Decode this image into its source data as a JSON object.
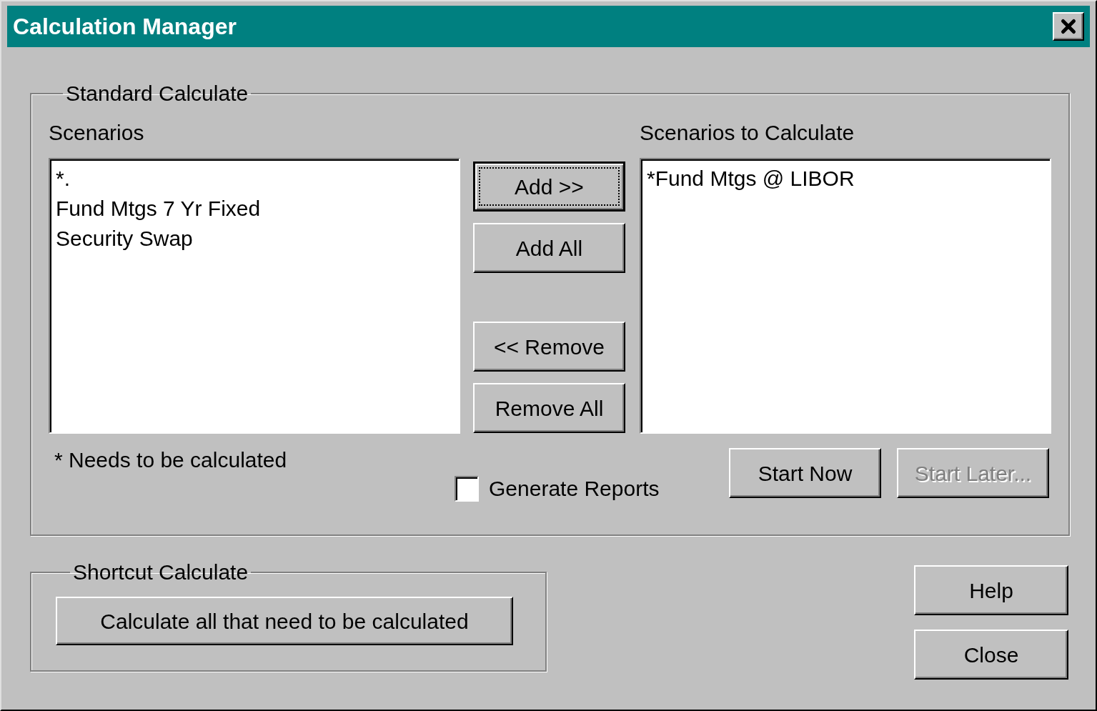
{
  "window": {
    "title": "Calculation Manager"
  },
  "standard_calculate": {
    "title": "Standard Calculate",
    "scenarios": {
      "label": "Scenarios",
      "items": [
        {
          "text": "*.",
          "selected": false
        },
        {
          "text": "Fund Mtgs 7 Yr Fixed",
          "selected": false
        },
        {
          "text": "Security Swap",
          "selected": false
        }
      ]
    },
    "move_buttons": [
      {
        "label": "Add >>",
        "focused": true,
        "disabled": false
      },
      {
        "label": "Add All",
        "focused": false,
        "disabled": false
      },
      {
        "label": "<< Remove",
        "focused": false,
        "disabled": false
      },
      {
        "label": "Remove All",
        "focused": false,
        "disabled": false
      }
    ],
    "scenarios_to_calculate": {
      "label": "Scenarios to Calculate",
      "items": [
        {
          "text": "*Fund Mtgs @ LIBOR",
          "selected": false
        }
      ]
    },
    "note": "* Needs to be calculated",
    "generate_reports": {
      "label": "Generate Reports",
      "checked": false
    },
    "start_buttons": [
      {
        "label": "Start Now",
        "focused": false,
        "disabled": false
      },
      {
        "label": "Start Later...",
        "focused": false,
        "disabled": true
      }
    ]
  },
  "shortcut_calculate": {
    "title": "Shortcut Calculate",
    "button": {
      "label": "Calculate all that need to be calculated",
      "focused": false,
      "disabled": false
    }
  },
  "side_buttons": [
    {
      "label": "Help",
      "focused": false,
      "disabled": false
    },
    {
      "label": "Close",
      "focused": false,
      "disabled": false
    }
  ]
}
